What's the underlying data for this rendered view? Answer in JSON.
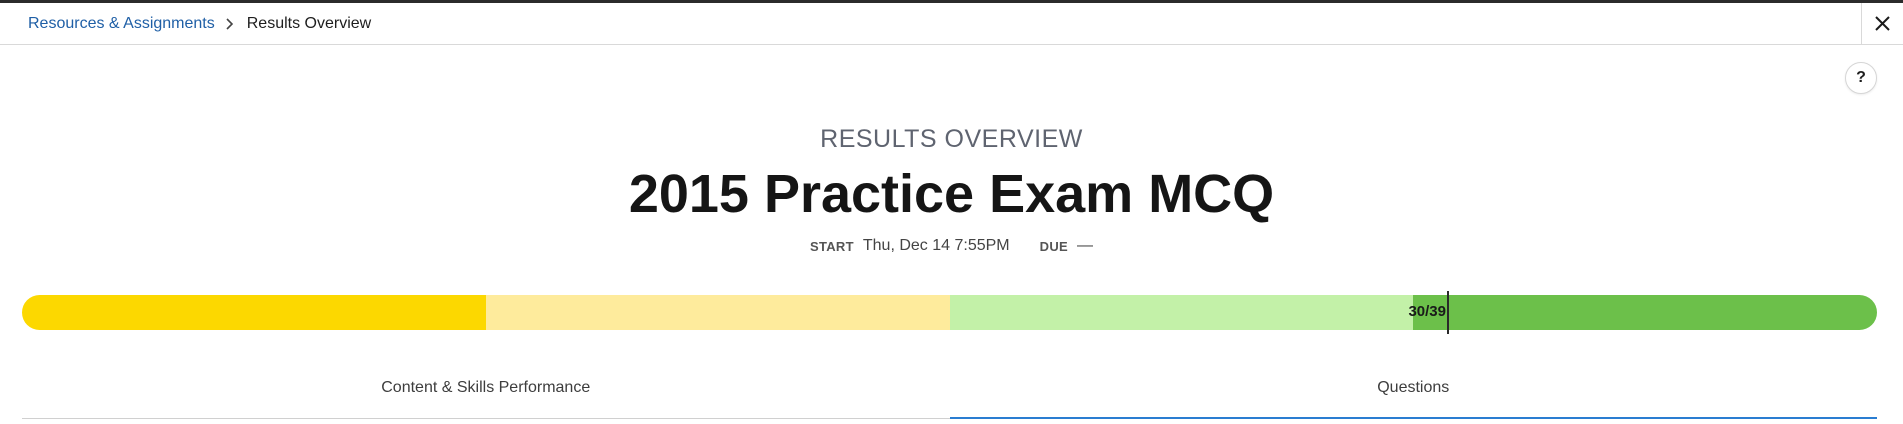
{
  "breadcrumb": {
    "parent": "Resources & Assignments",
    "current": "Results Overview"
  },
  "header": {
    "eyebrow": "RESULTS OVERVIEW",
    "title": "2015 Practice Exam MCQ",
    "start_label": "START",
    "start_value": "Thu, Dec 14 7:55PM",
    "due_label": "DUE",
    "due_value": "—"
  },
  "help": {
    "label": "?"
  },
  "close": {
    "icon": "close-icon"
  },
  "score": {
    "label": "30/39",
    "correct": 30,
    "total": 39,
    "colors": [
      "#fcd800",
      "#feeb9c",
      "#c3f1a8",
      "#6cc04a"
    ]
  },
  "tabs": [
    {
      "label": "Content & Skills Performance",
      "active": false
    },
    {
      "label": "Questions",
      "active": true
    }
  ],
  "colors": {
    "link": "#1f5fa6",
    "tab_active": "#2a7dd1"
  }
}
